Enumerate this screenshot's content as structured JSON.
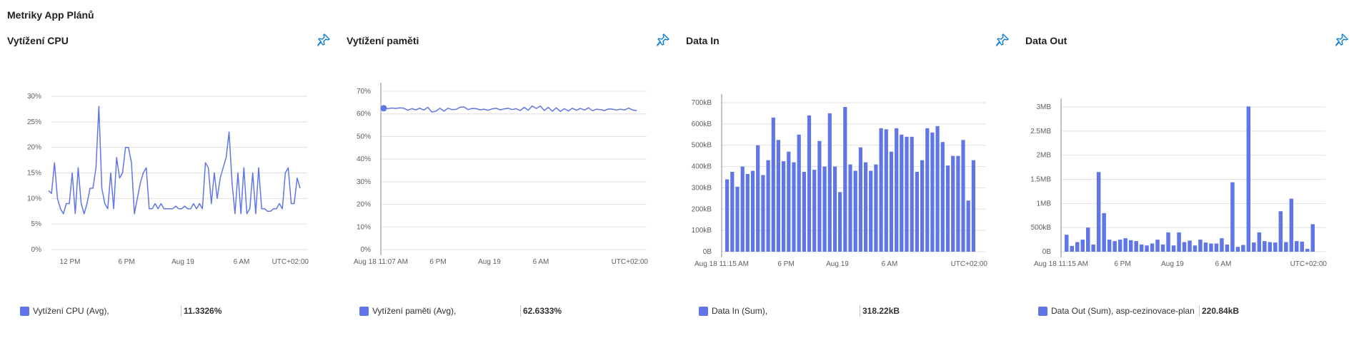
{
  "page_title": "Metriky App Plánů",
  "pin_icon": "pin-icon",
  "accent_color": "#6076e6",
  "cards": [
    {
      "title": "Vytížení CPU",
      "legend_name": "Vytížení CPU (Avg),",
      "legend_value": "11.3326%",
      "y_ticks": [
        "0%",
        "5%",
        "10%",
        "15%",
        "20%",
        "25%",
        "30%"
      ],
      "x_ticks": [
        "12 PM",
        "6 PM",
        "Aug 19",
        "6 AM"
      ],
      "x_start_label": "",
      "timezone": "UTC+02:00"
    },
    {
      "title": "Vytížení paměti",
      "legend_name": "Vytížení paměti (Avg),",
      "legend_value": "62.6333%",
      "y_ticks": [
        "0%",
        "10%",
        "20%",
        "30%",
        "40%",
        "50%",
        "60%",
        "70%"
      ],
      "x_ticks": [
        "6 PM",
        "Aug 19",
        "6 AM"
      ],
      "x_start_label": "Aug 18 11:07 AM",
      "timezone": "UTC+02:00"
    },
    {
      "title": "Data In",
      "legend_name": "Data In (Sum),",
      "legend_value": "318.22kB",
      "y_ticks": [
        "0B",
        "100kB",
        "200kB",
        "300kB",
        "400kB",
        "500kB",
        "600kB",
        "700kB"
      ],
      "x_ticks": [
        "6 PM",
        "Aug 19",
        "6 AM"
      ],
      "x_start_label": "Aug 18 11:15 AM",
      "timezone": "UTC+02:00"
    },
    {
      "title": "Data Out",
      "legend_name": "Data Out (Sum), asp-cezinovace-plan",
      "legend_value": "220.84kB",
      "y_ticks": [
        "0B",
        "500kB",
        "1MB",
        "1.5MB",
        "2MB",
        "2.5MB",
        "3MB"
      ],
      "x_ticks": [
        "6 PM",
        "Aug 19",
        "6 AM"
      ],
      "x_start_label": "Aug 18 11:15 AM",
      "timezone": "UTC+02:00"
    }
  ],
  "chart_data": [
    {
      "type": "line",
      "title": "Vytížení CPU",
      "ylabel": "",
      "ylim": [
        0,
        30
      ],
      "series": [
        {
          "name": "Vytížení CPU (Avg)",
          "values": [
            11.5,
            11,
            17,
            10,
            8,
            7,
            9,
            9,
            15,
            7,
            16,
            9,
            7,
            9,
            12,
            12,
            16,
            28,
            12,
            9,
            8,
            15,
            8,
            18,
            14,
            15,
            20,
            20,
            17,
            7,
            10,
            13,
            15,
            16,
            8,
            8,
            9,
            8,
            9,
            8,
            8,
            8,
            8,
            8.5,
            8,
            8,
            8.5,
            8,
            8,
            9,
            8,
            9,
            8,
            17,
            16,
            9,
            15,
            10,
            14,
            16,
            18,
            23,
            13,
            7,
            15,
            7,
            16,
            7,
            8,
            15,
            7,
            16,
            8,
            8,
            7.5,
            7.5,
            8,
            8,
            9,
            8,
            15,
            16,
            9,
            9,
            14,
            12
          ]
        }
      ]
    },
    {
      "type": "line",
      "title": "Vytížení paměti",
      "ylabel": "",
      "ylim": [
        0,
        70
      ],
      "series": [
        {
          "name": "Vytížení paměti (Avg)",
          "values": [
            62.5,
            62.3,
            62.6,
            62.4,
            62.7,
            62.5,
            61.6,
            62.3,
            61.8,
            62.5,
            61.7,
            62.9,
            60.8,
            61.2,
            62.5,
            61.2,
            62.5,
            61.9,
            62,
            62.9,
            63.1,
            61.9,
            62.4,
            62.3,
            61.8,
            62.1,
            61.6,
            62.2,
            62.5,
            61.8,
            62.2,
            62.5,
            61.9,
            62.3,
            61.5,
            62.9,
            61.6,
            63.5,
            62.4,
            63.5,
            61.5,
            62.9,
            61.2,
            62.7,
            61.1,
            62.3,
            61.3,
            62.5,
            61.6,
            62.4,
            61.7,
            62.7,
            61.4,
            62.1,
            61.9,
            61.5,
            62.2,
            62.1,
            61.7,
            62.1,
            61.7,
            62.6,
            61.7,
            61.5
          ]
        }
      ]
    },
    {
      "type": "bar",
      "title": "Data In",
      "ylabel": "",
      "ylim": [
        0,
        750
      ],
      "unit": "kB",
      "series": [
        {
          "name": "Data In (Sum)",
          "values": [
            340,
            375,
            305,
            400,
            365,
            380,
            500,
            360,
            430,
            630,
            525,
            425,
            470,
            420,
            550,
            375,
            640,
            385,
            520,
            400,
            650,
            400,
            280,
            680,
            410,
            380,
            490,
            420,
            380,
            410,
            580,
            575,
            470,
            580,
            550,
            540,
            540,
            375,
            430,
            580,
            560,
            590,
            515,
            405,
            450,
            450,
            525,
            240,
            430
          ]
        }
      ]
    },
    {
      "type": "bar",
      "title": "Data Out",
      "ylabel": "",
      "ylim": [
        0,
        3300
      ],
      "unit": "kB",
      "series": [
        {
          "name": "Data Out (Sum), asp-cezinovace-plan",
          "values": [
            350,
            120,
            200,
            250,
            500,
            150,
            1650,
            800,
            250,
            220,
            250,
            280,
            240,
            220,
            150,
            130,
            170,
            250,
            150,
            400,
            130,
            400,
            200,
            230,
            130,
            250,
            190,
            170,
            170,
            280,
            150,
            1440,
            100,
            140,
            3010,
            190,
            400,
            220,
            200,
            190,
            840,
            200,
            1100,
            220,
            210,
            60,
            570
          ]
        }
      ]
    }
  ]
}
